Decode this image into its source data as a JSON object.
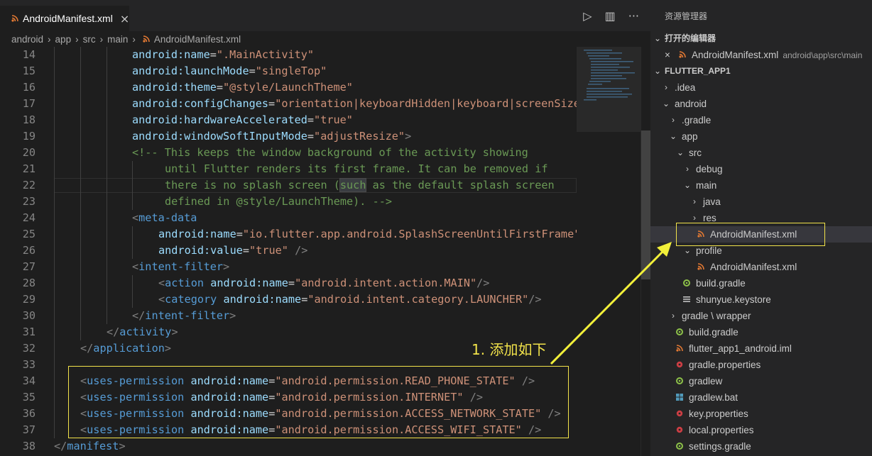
{
  "tab": {
    "title": "AndroidManifest.xml",
    "close": "×"
  },
  "actions": {
    "run": "▷",
    "split": "▥",
    "more": "···"
  },
  "breadcrumb": [
    "android",
    "app",
    "src",
    "main",
    "AndroidManifest.xml"
  ],
  "code_lines": [
    {
      "n": "14",
      "indent": 186,
      "parts": [
        [
          "a",
          "android:name"
        ],
        [
          "w",
          "="
        ],
        [
          "s",
          "\".MainActivity\""
        ]
      ]
    },
    {
      "n": "15",
      "indent": 186,
      "parts": [
        [
          "a",
          "android:launchMode"
        ],
        [
          "w",
          "="
        ],
        [
          "s",
          "\"singleTop\""
        ]
      ]
    },
    {
      "n": "16",
      "indent": 186,
      "parts": [
        [
          "a",
          "android:theme"
        ],
        [
          "w",
          "="
        ],
        [
          "s",
          "\"@style/LaunchTheme\""
        ]
      ]
    },
    {
      "n": "17",
      "indent": 186,
      "parts": [
        [
          "a",
          "android:configChanges"
        ],
        [
          "w",
          "="
        ],
        [
          "s",
          "\"orientation|keyboardHidden|keyboard|screenSize"
        ]
      ]
    },
    {
      "n": "18",
      "indent": 186,
      "parts": [
        [
          "a",
          "android:hardwareAccelerated"
        ],
        [
          "w",
          "="
        ],
        [
          "s",
          "\"true\""
        ]
      ]
    },
    {
      "n": "19",
      "indent": 186,
      "parts": [
        [
          "a",
          "android:windowSoftInputMode"
        ],
        [
          "w",
          "="
        ],
        [
          "s",
          "\"adjustResize\""
        ],
        [
          "p",
          ">"
        ]
      ]
    },
    {
      "n": "20",
      "indent": 186,
      "parts": [
        [
          "c",
          "<!-- This keeps the window background of the activity showing"
        ]
      ]
    },
    {
      "n": "21",
      "indent": 232,
      "parts": [
        [
          "c",
          "until Flutter renders its first frame. It can be removed if"
        ]
      ]
    },
    {
      "n": "22",
      "indent": 232,
      "parts": [
        [
          "c",
          "there is no splash screen ("
        ],
        [
          "chl",
          "such"
        ],
        [
          "c",
          " as the default splash screen"
        ]
      ]
    },
    {
      "n": "23",
      "indent": 232,
      "parts": [
        [
          "c",
          "defined in @style/LaunchTheme). -->"
        ]
      ]
    },
    {
      "n": "24",
      "indent": 186,
      "parts": [
        [
          "p",
          "<"
        ],
        [
          "t",
          "meta-data"
        ]
      ]
    },
    {
      "n": "25",
      "indent": 223,
      "parts": [
        [
          "a",
          "android:name"
        ],
        [
          "w",
          "="
        ],
        [
          "s",
          "\"io.flutter.app.android.SplashScreenUntilFirstFrame\""
        ]
      ]
    },
    {
      "n": "26",
      "indent": 223,
      "parts": [
        [
          "a",
          "android:value"
        ],
        [
          "w",
          "="
        ],
        [
          "s",
          "\"true\""
        ],
        [
          "w",
          " "
        ],
        [
          "p",
          "/>"
        ]
      ]
    },
    {
      "n": "27",
      "indent": 186,
      "parts": [
        [
          "p",
          "<"
        ],
        [
          "t",
          "intent-filter"
        ],
        [
          "p",
          ">"
        ]
      ]
    },
    {
      "n": "28",
      "indent": 223,
      "parts": [
        [
          "p",
          "<"
        ],
        [
          "t",
          "action"
        ],
        [
          "w",
          " "
        ],
        [
          "a",
          "android:name"
        ],
        [
          "w",
          "="
        ],
        [
          "s",
          "\"android.intent.action.MAIN\""
        ],
        [
          "p",
          "/>"
        ]
      ]
    },
    {
      "n": "29",
      "indent": 223,
      "parts": [
        [
          "p",
          "<"
        ],
        [
          "t",
          "category"
        ],
        [
          "w",
          " "
        ],
        [
          "a",
          "android:name"
        ],
        [
          "w",
          "="
        ],
        [
          "s",
          "\"android.intent.category.LAUNCHER\""
        ],
        [
          "p",
          "/>"
        ]
      ]
    },
    {
      "n": "30",
      "indent": 186,
      "parts": [
        [
          "p",
          "</"
        ],
        [
          "t",
          "intent-filter"
        ],
        [
          "p",
          ">"
        ]
      ]
    },
    {
      "n": "31",
      "indent": 150,
      "parts": [
        [
          "p",
          "</"
        ],
        [
          "t",
          "activity"
        ],
        [
          "p",
          ">"
        ]
      ]
    },
    {
      "n": "32",
      "indent": 113,
      "parts": [
        [
          "p",
          "</"
        ],
        [
          "t",
          "application"
        ],
        [
          "p",
          ">"
        ]
      ]
    },
    {
      "n": "33",
      "indent": 113,
      "parts": []
    },
    {
      "n": "34",
      "indent": 113,
      "parts": [
        [
          "p",
          "<"
        ],
        [
          "t",
          "uses-permission"
        ],
        [
          "w",
          " "
        ],
        [
          "a",
          "android:name"
        ],
        [
          "w",
          "="
        ],
        [
          "s",
          "\"android.permission.READ_PHONE_STATE\""
        ],
        [
          "w",
          " "
        ],
        [
          "p",
          "/>"
        ]
      ]
    },
    {
      "n": "35",
      "indent": 113,
      "parts": [
        [
          "p",
          "<"
        ],
        [
          "t",
          "uses-permission"
        ],
        [
          "w",
          " "
        ],
        [
          "a",
          "android:name"
        ],
        [
          "w",
          "="
        ],
        [
          "s",
          "\"android.permission.INTERNET\""
        ],
        [
          "w",
          " "
        ],
        [
          "p",
          "/>"
        ]
      ]
    },
    {
      "n": "36",
      "indent": 113,
      "parts": [
        [
          "p",
          "<"
        ],
        [
          "t",
          "uses-permission"
        ],
        [
          "w",
          " "
        ],
        [
          "a",
          "android:name"
        ],
        [
          "w",
          "="
        ],
        [
          "s",
          "\"android.permission.ACCESS_NETWORK_STATE\""
        ],
        [
          "w",
          " "
        ],
        [
          "p",
          "/>"
        ]
      ]
    },
    {
      "n": "37",
      "indent": 113,
      "parts": [
        [
          "p",
          "<"
        ],
        [
          "t",
          "uses-permission"
        ],
        [
          "w",
          " "
        ],
        [
          "a",
          "android:name"
        ],
        [
          "w",
          "="
        ],
        [
          "s",
          "\"android.permission.ACCESS_WIFI_STATE\""
        ],
        [
          "w",
          " "
        ],
        [
          "p",
          "/>"
        ]
      ]
    },
    {
      "n": "38",
      "indent": 76,
      "parts": [
        [
          "p",
          "</"
        ],
        [
          "t",
          "manifest"
        ],
        [
          "p",
          ">"
        ]
      ]
    }
  ],
  "annotation": "1. 添加如下",
  "explorer": {
    "title": "资源管理器",
    "open_editors": "打开的编辑器",
    "open_file": {
      "name": "AndroidManifest.xml",
      "path": "android\\app\\src\\main"
    },
    "project": "FLUTTER_APP1",
    "tree": [
      {
        "label": ".idea",
        "depth": 0,
        "arrow": "›",
        "icon": ""
      },
      {
        "label": "android",
        "depth": 0,
        "arrow": "⌄",
        "icon": ""
      },
      {
        "label": ".gradle",
        "depth": 1,
        "arrow": "›",
        "icon": ""
      },
      {
        "label": "app",
        "depth": 1,
        "arrow": "⌄",
        "icon": ""
      },
      {
        "label": "src",
        "depth": 2,
        "arrow": "⌄",
        "icon": ""
      },
      {
        "label": "debug",
        "depth": 3,
        "arrow": "›",
        "icon": ""
      },
      {
        "label": "main",
        "depth": 3,
        "arrow": "⌄",
        "icon": ""
      },
      {
        "label": "java",
        "depth": 4,
        "arrow": "›",
        "icon": ""
      },
      {
        "label": "res",
        "depth": 4,
        "arrow": "›",
        "icon": ""
      },
      {
        "label": "AndroidManifest.xml",
        "depth": 4,
        "arrow": "",
        "icon": "rss",
        "selected": true
      },
      {
        "label": "profile",
        "depth": 3,
        "arrow": "⌄",
        "icon": ""
      },
      {
        "label": "AndroidManifest.xml",
        "depth": 4,
        "arrow": "",
        "icon": "rss"
      },
      {
        "label": "build.gradle",
        "depth": 2,
        "arrow": "",
        "icon": "gradle"
      },
      {
        "label": "shunyue.keystore",
        "depth": 2,
        "arrow": "",
        "icon": "lines"
      },
      {
        "label": "gradle \\ wrapper",
        "depth": 1,
        "arrow": "›",
        "icon": ""
      },
      {
        "label": "build.gradle",
        "depth": 1,
        "arrow": "",
        "icon": "gradle"
      },
      {
        "label": "flutter_app1_android.iml",
        "depth": 1,
        "arrow": "",
        "icon": "rss"
      },
      {
        "label": "gradle.properties",
        "depth": 1,
        "arrow": "",
        "icon": "red"
      },
      {
        "label": "gradlew",
        "depth": 1,
        "arrow": "",
        "icon": "gradle"
      },
      {
        "label": "gradlew.bat",
        "depth": 1,
        "arrow": "",
        "icon": "win"
      },
      {
        "label": "key.properties",
        "depth": 1,
        "arrow": "",
        "icon": "red"
      },
      {
        "label": "local.properties",
        "depth": 1,
        "arrow": "",
        "icon": "red"
      },
      {
        "label": "settings.gradle",
        "depth": 1,
        "arrow": "",
        "icon": "gradle"
      }
    ]
  },
  "colors": {
    "accent_yellow": "#f2e34a",
    "rss_orange": "#e37933",
    "gradle_green": "#8dc149",
    "prop_red": "#cc3e44",
    "win_blue": "#519aba"
  }
}
